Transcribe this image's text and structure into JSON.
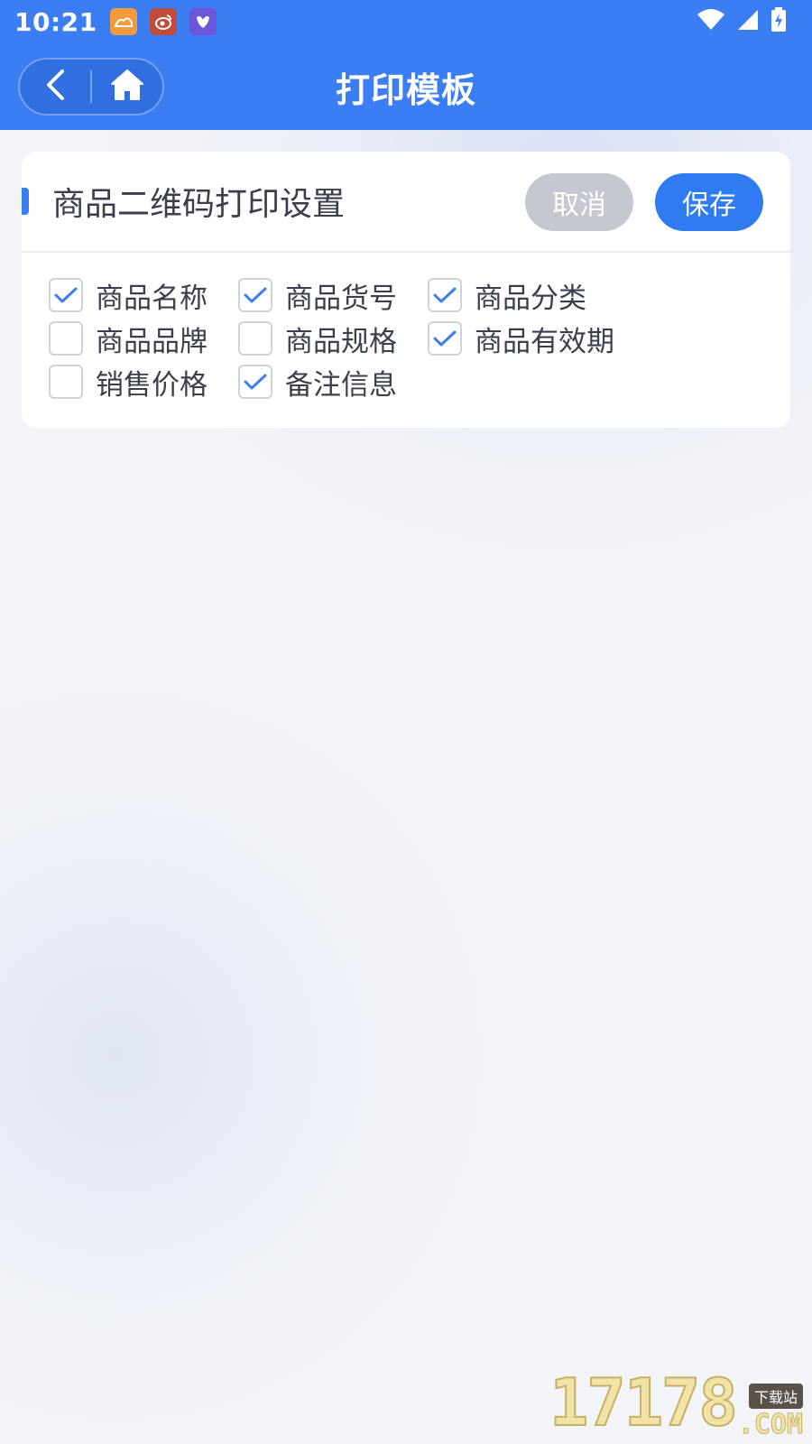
{
  "status_bar": {
    "time": "10:21",
    "notifications": [
      "app-notification-icon",
      "weibo-icon",
      "pigeon-app-icon"
    ],
    "system": [
      "wifi-icon",
      "signal-icon",
      "battery-charging-icon"
    ]
  },
  "title_bar": {
    "title": "打印模板",
    "nav": [
      "back-icon",
      "home-icon"
    ]
  },
  "colors": {
    "primary": "#3b7df2",
    "cancel": "#c5c8d0",
    "text": "#3a3f4b"
  },
  "card": {
    "title": "商品二维码打印设置",
    "cancel_label": "取消",
    "save_label": "保存",
    "options": [
      {
        "label": "商品名称",
        "checked": true
      },
      {
        "label": "商品货号",
        "checked": true
      },
      {
        "label": "商品分类",
        "checked": true
      },
      {
        "label": "商品品牌",
        "checked": false
      },
      {
        "label": "商品规格",
        "checked": false
      },
      {
        "label": "商品有效期",
        "checked": true
      },
      {
        "label": "销售价格",
        "checked": false
      },
      {
        "label": "备注信息",
        "checked": true
      }
    ]
  },
  "watermark": {
    "number": "17178",
    "tag": "下载站",
    "suffix": ".COM"
  }
}
